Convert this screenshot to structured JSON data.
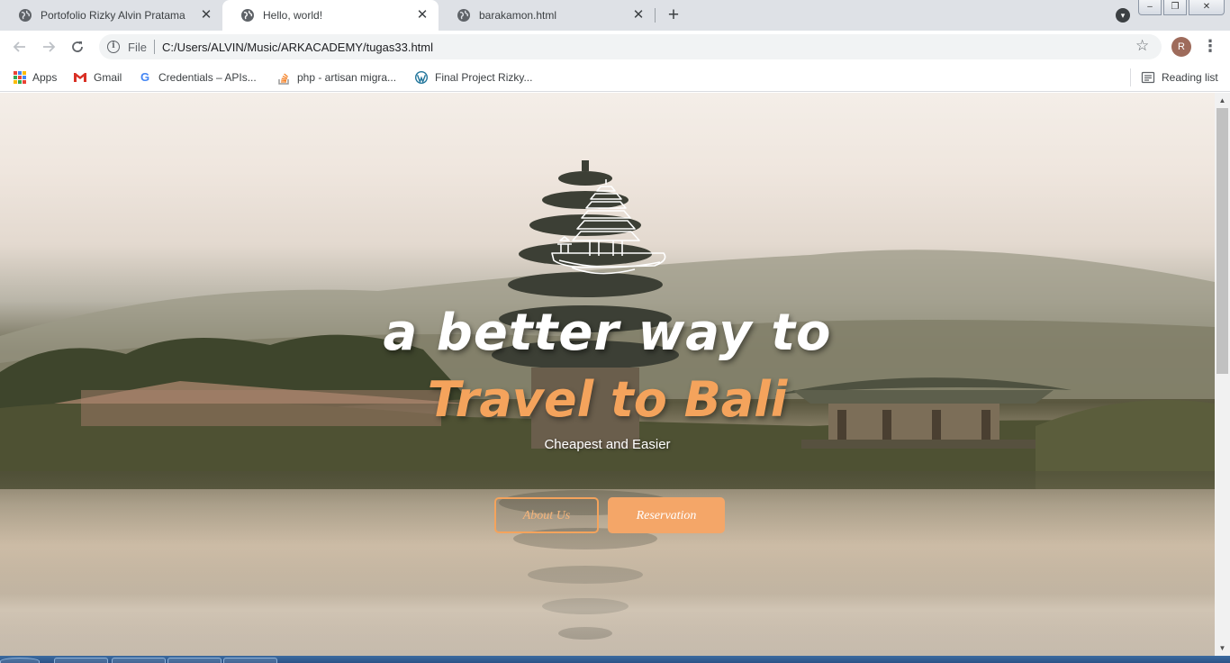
{
  "browser": {
    "tabs": [
      {
        "title": "Portofolio Rizky Alvin Pratama",
        "active": false
      },
      {
        "title": "Hello, world!",
        "active": true
      },
      {
        "title": "barakamon.html",
        "active": false
      }
    ],
    "new_tab_symbol": "+",
    "tab_close_symbol": "✕",
    "window_buttons": [
      "–",
      "❐",
      "✕"
    ],
    "address": {
      "scheme_label": "File",
      "url": "C:/Users/ALVIN/Music/ARKACADEMY/tugas33.html"
    },
    "profile_initial": "R",
    "bookmarks": [
      {
        "label": "Apps",
        "icon": "apps-grid-icon"
      },
      {
        "label": "Gmail",
        "icon": "gmail-icon"
      },
      {
        "label": "Credentials – APIs...",
        "icon": "google-icon"
      },
      {
        "label": "php - artisan migra...",
        "icon": "stackoverflow-icon"
      },
      {
        "label": "Final Project Rizky...",
        "icon": "wordpress-icon"
      }
    ],
    "reading_list": "Reading list"
  },
  "page": {
    "headline": "a better way to",
    "headline_accent": "Travel to Bali",
    "tagline": "Cheapest and Easier",
    "buttons": {
      "about": "About Us",
      "reservation": "Reservation"
    }
  },
  "colors": {
    "accent": "#f4a35c",
    "button_fill": "#f4a668",
    "tab_strip": "#dee1e6",
    "omnibox": "#f1f3f4"
  }
}
